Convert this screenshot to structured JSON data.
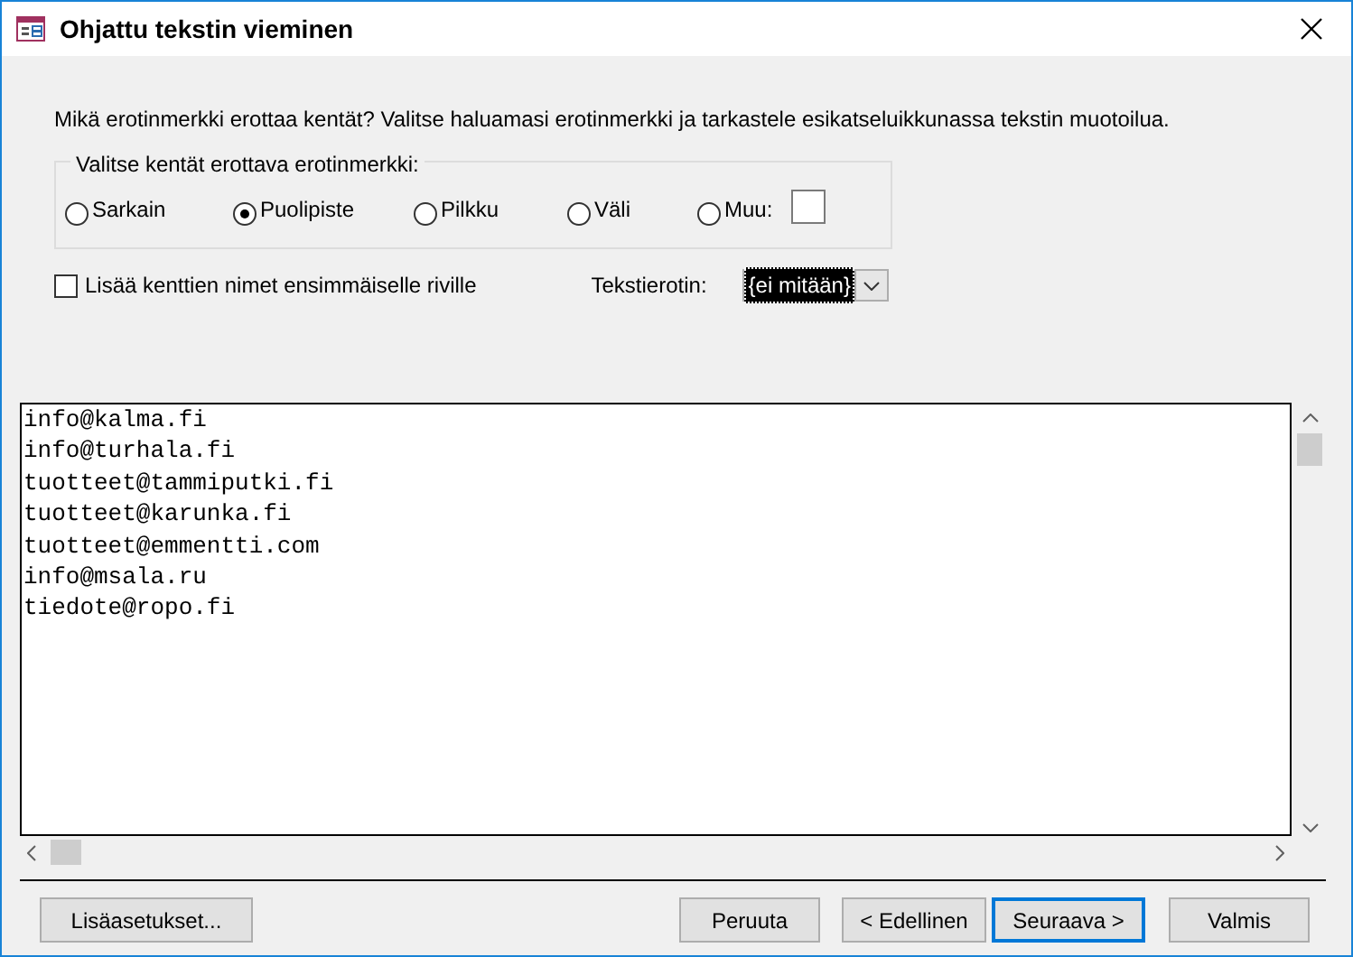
{
  "window": {
    "title": "Ohjattu tekstin vieminen"
  },
  "instruction": "Mikä erotinmerkki erottaa kentät?  Valitse haluamasi erotinmerkki ja tarkastele esikatseluikkunassa tekstin muotoilua.",
  "delimiter_group": {
    "label": "Valitse kentät erottava erotinmerkki:",
    "options": [
      {
        "label": "Sarkain",
        "selected": false
      },
      {
        "label": "Puolipiste",
        "selected": true
      },
      {
        "label": "Pilkku",
        "selected": false
      },
      {
        "label": "Väli",
        "selected": false
      },
      {
        "label": "Muu:",
        "selected": false
      }
    ]
  },
  "field_names_checkbox": {
    "label": "Lisää kenttien nimet ensimmäiselle riville",
    "checked": false
  },
  "text_qualifier": {
    "label": "Tekstierotin:",
    "value": "{ei mitään}"
  },
  "preview": {
    "lines": [
      "info@kalma.fi",
      "info@turhala.fi",
      "tuotteet@tammiputki.fi",
      "tuotteet@karunka.fi",
      "tuotteet@emmentti.com",
      "info@msala.ru",
      "tiedote@ropo.fi"
    ]
  },
  "buttons": [
    {
      "label": "Lisäasetukset...",
      "default": false
    },
    {
      "label": "Peruuta",
      "default": false
    },
    {
      "label": "< Edellinen",
      "default": false
    },
    {
      "label": "Seuraava >",
      "default": true
    },
    {
      "label": "Valmis",
      "default": false
    }
  ]
}
